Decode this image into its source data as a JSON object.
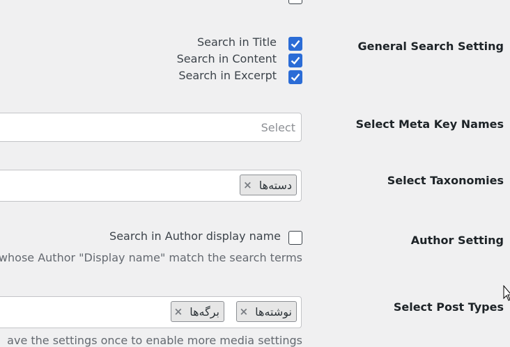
{
  "general": {
    "label": "General Search Setting",
    "options": [
      {
        "label": "Search in Title",
        "checked": true
      },
      {
        "label": "Search in Content",
        "checked": true
      },
      {
        "label": "Search in Excerpt",
        "checked": true
      }
    ]
  },
  "meta": {
    "label": "Select Meta Key Names",
    "placeholder": "Select"
  },
  "taxonomies": {
    "label": "Select Taxonomies",
    "tags": [
      {
        "text": "دسته‌ها",
        "remove": "×"
      }
    ]
  },
  "author": {
    "label": "Author Setting",
    "option": "Search in Author display name",
    "checked": false,
    "description": "whose Author \"Display name\" match the search terms"
  },
  "post_types": {
    "label": "Select Post Types",
    "tags": [
      {
        "text": "نوشته‌ها",
        "remove": "×"
      },
      {
        "text": "برگه‌ها",
        "remove": "×"
      }
    ],
    "description": "ave the settings once to enable more media settings"
  },
  "colors": {
    "checkbox": "#2b6cd6",
    "background": "#f0f0f1"
  },
  "icons": {
    "check": "check-icon",
    "remove": "close-icon",
    "cursor": "mouse-cursor-icon"
  }
}
